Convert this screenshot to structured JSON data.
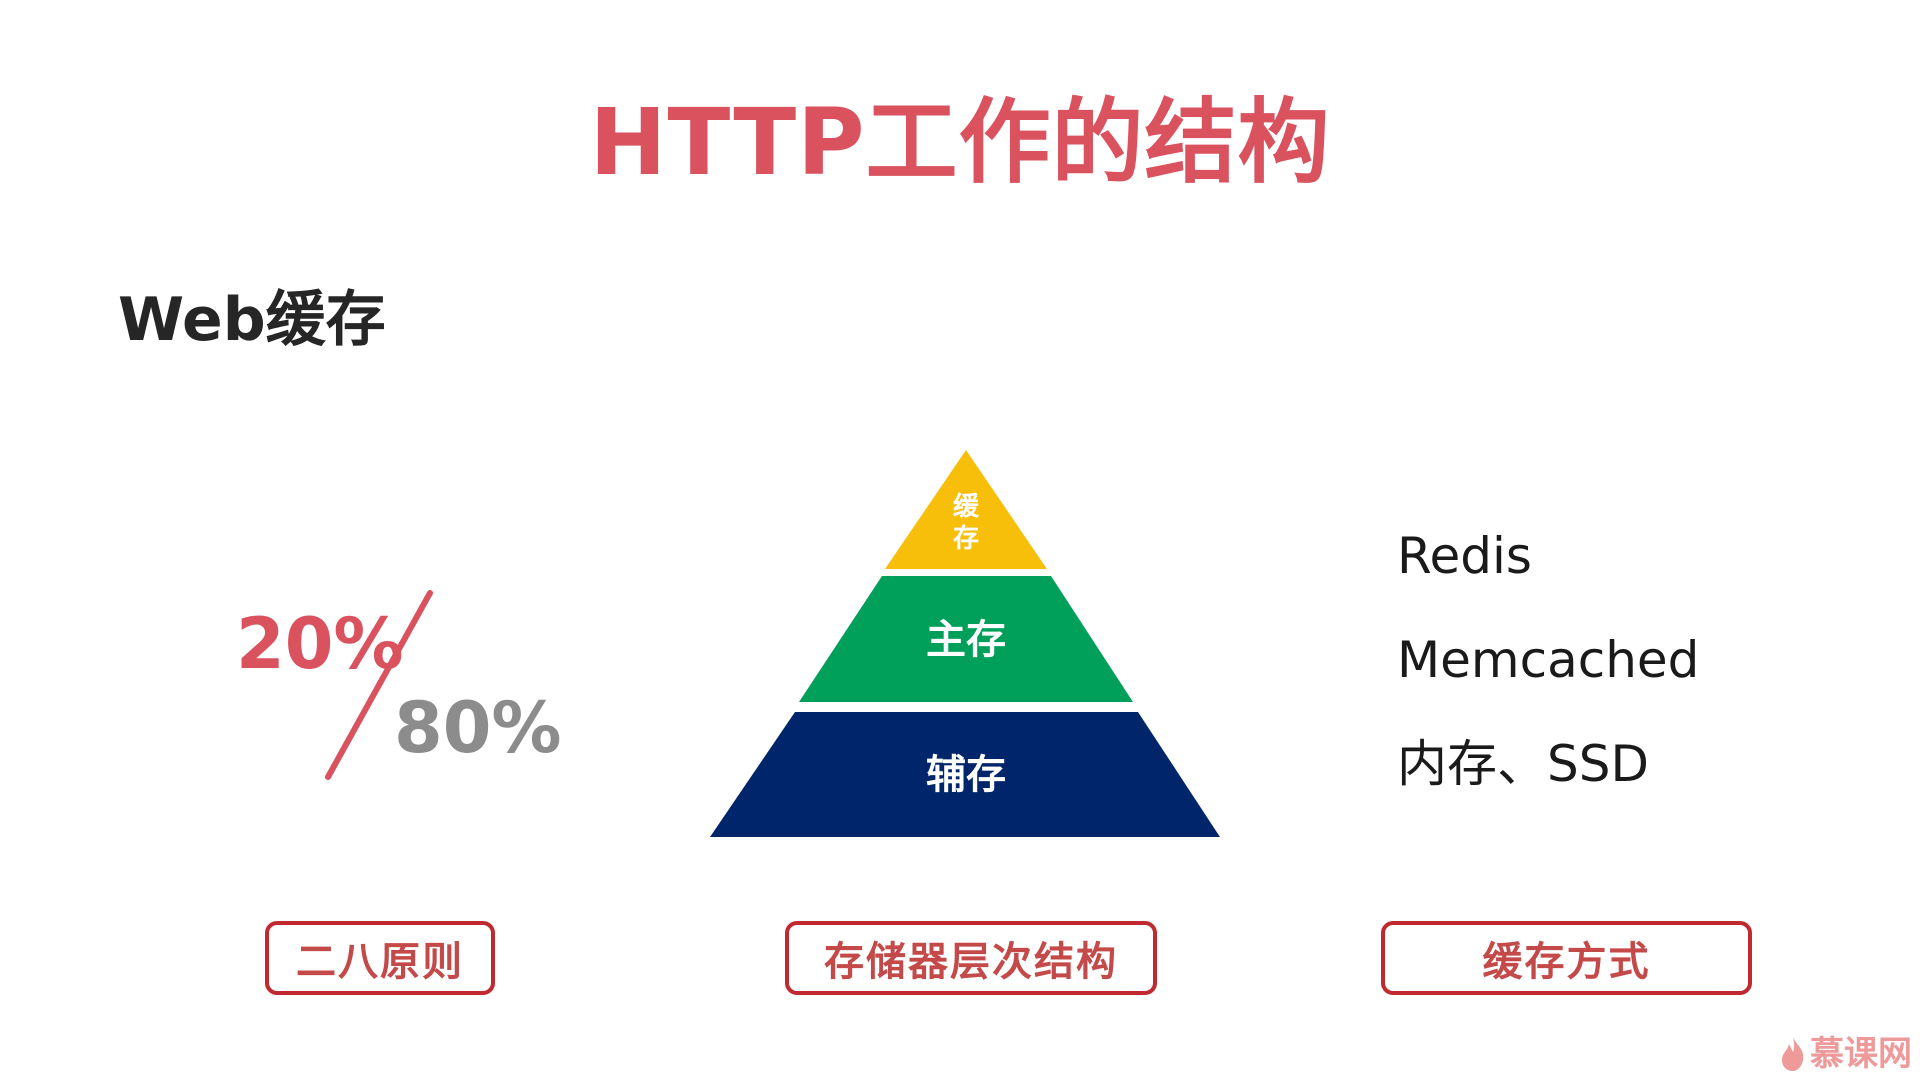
{
  "slide": {
    "title": "HTTP工作的结构",
    "section_title": "Web缓存"
  },
  "rule_2080": {
    "twenty": "20%",
    "eighty": "80%"
  },
  "pyramid": {
    "top": {
      "label_line1": "缓",
      "label_line2": "存",
      "color": "#f7bf0a"
    },
    "middle": {
      "label": "主存",
      "color": "#00a05a"
    },
    "bottom": {
      "label": "辅存",
      "color": "#00256a"
    }
  },
  "cache_methods": [
    "Redis",
    "Memcached",
    "内存、SSD"
  ],
  "labels": {
    "rule": "二八原则",
    "hierarchy": "存储器层次结构",
    "method": "缓存方式"
  },
  "watermark": {
    "text": "慕课网",
    "icon": "flame-icon"
  },
  "colors": {
    "accent_red": "#d9525e",
    "label_border": "#c0292f",
    "muted_gray": "#8c8c8c"
  }
}
